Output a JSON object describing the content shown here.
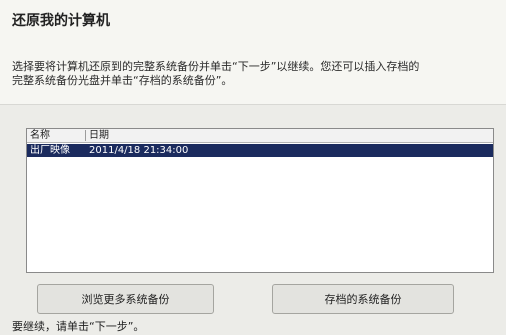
{
  "window": {
    "title": "还原我的计算机",
    "description_line1": "选择要将计算机还原到的完整系统备份并单击“下一步”以继续。您还可以插入存档的",
    "description_line2": "完整系统备份光盘并单击“存档的系统备份”。"
  },
  "backup_list": {
    "columns": [
      "名称",
      "日期"
    ],
    "rows": [
      {
        "name": "出厂映像",
        "date": "2011/4/18 21:34:00",
        "selected": true
      }
    ]
  },
  "buttons": {
    "browse_label": "浏览更多系统备份",
    "archived_label": "存档的系统备份"
  },
  "footer": {
    "text": "要继续，请单击“下一步”。"
  }
}
